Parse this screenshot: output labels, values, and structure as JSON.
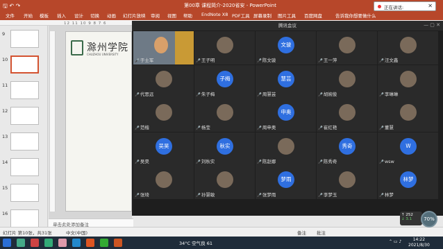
{
  "ppt": {
    "doc_title": "第00章 课程简介-2020省安 - PowerPoint",
    "tabs": [
      "文件",
      "开始",
      "模板",
      "插入",
      "设计",
      "切换",
      "动画",
      "幻灯片放映",
      "审阅",
      "视图",
      "帮助",
      "EndNote X8",
      "PDF工具",
      "屏幕录制",
      "图片工具",
      "百度网盘",
      "告诉我你想要做什么"
    ],
    "thumb_numbers": [
      "9",
      "10",
      "11",
      "12",
      "13",
      "14",
      "15",
      "16"
    ],
    "ruler": "12 11 10 9 8 7 6",
    "uni_name": "滁州学院",
    "uni_en": "CHUZHOU UNIVERSITY",
    "notes": "单击此处添加备注",
    "status": {
      "slide": "幻灯片 第10张，共31张",
      "lang": "中文(中国)",
      "notes": "备注",
      "comments": "批注"
    }
  },
  "meeting": {
    "title": "腾讯会议",
    "float_label": "正在讲话:",
    "tiles": [
      [
        {
          "n": "于士军",
          "t": "video"
        },
        {
          "n": "王子明",
          "t": "img"
        },
        {
          "n": "陈文骏",
          "t": "blue",
          "a": "文骏"
        },
        {
          "n": "王一萍",
          "t": "img"
        },
        {
          "n": "汪文鑫",
          "t": "img"
        }
      ],
      [
        {
          "n": "代思远",
          "t": "img"
        },
        {
          "n": "朱子梅",
          "t": "blue",
          "a": "子梅"
        },
        {
          "n": "周慧芸",
          "t": "blue",
          "a": "慧芸"
        },
        {
          "n": "胡婉俊",
          "t": "img"
        },
        {
          "n": "李琳琳",
          "t": "img"
        }
      ],
      [
        {
          "n": "范楷",
          "t": "img"
        },
        {
          "n": "杨莹",
          "t": "img"
        },
        {
          "n": "周申奥",
          "t": "blue",
          "a": "申奥"
        },
        {
          "n": "崔红艳",
          "t": "img"
        },
        {
          "n": "董慧",
          "t": "img"
        }
      ],
      [
        {
          "n": "吴昊",
          "t": "blue",
          "a": "吴昊"
        },
        {
          "n": "刘秋实",
          "t": "blue",
          "a": "秋实"
        },
        {
          "n": "陈赵娜",
          "t": "img"
        },
        {
          "n": "陈秀奇",
          "t": "blue",
          "a": "秀奇"
        },
        {
          "n": "wsw",
          "t": "blue",
          "a": "W"
        }
      ],
      [
        {
          "n": "张琦",
          "t": "img"
        },
        {
          "n": "孙慧敏",
          "t": "img"
        },
        {
          "n": "张梦雨",
          "t": "blue",
          "a": "梦雨"
        },
        {
          "n": "李梦玉",
          "t": "img"
        },
        {
          "n": "林梦",
          "t": "blue",
          "a": "林梦"
        }
      ]
    ],
    "net_up": "252",
    "net_down": "3.1",
    "cpu": "70%"
  },
  "taskbar": {
    "weather": "34°C 空气良 61",
    "time": "14:22",
    "date": "2021/8/30"
  },
  "colors": {
    "ppt_red": "#b7472a",
    "avatar_blue": "#2f6fe0",
    "meeting_bg": "#1e1e1e"
  }
}
